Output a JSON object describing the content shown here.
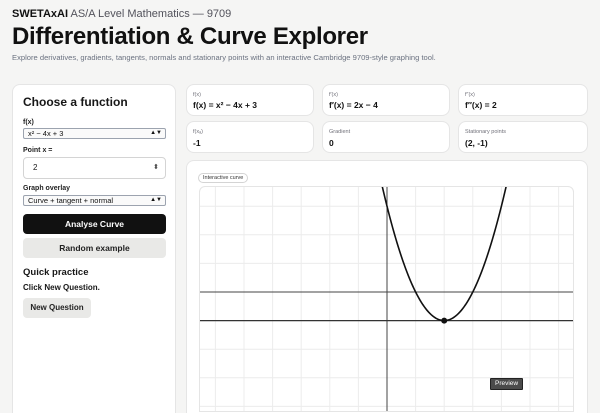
{
  "header": {
    "brand": "SWETAxAI",
    "course": "AS/A Level Mathematics — 9709",
    "title": "Differentiation & Curve Explorer",
    "subtitle": "Explore derivatives, gradients, tangents, normals and stationary points with an interactive Cambridge 9709-style graphing tool."
  },
  "panel": {
    "title": "Choose a function",
    "function_label": "f(x)",
    "function_value": "x² − 4x + 3",
    "point_label": "Point x =",
    "point_value": "2",
    "overlay_label": "Graph overlay",
    "overlay_value": "Curve + tangent + normal",
    "analyse_button": "Analyse Curve",
    "random_button": "Random example",
    "practice_title": "Quick practice",
    "practice_text": "Click New Question.",
    "new_question_button": "New Question"
  },
  "cards": {
    "fx_label": "f(x)",
    "fx_value": "f(x) = x² − 4x + 3",
    "d1_label": "f′(x)",
    "d1_value": "f′(x) = 2x − 4",
    "d2_label": "f″(x)",
    "d2_value": "f″(x) = 2",
    "fxa_label": "f(xₐ)",
    "fxa_value": "-1",
    "gradient_label": "Gradient",
    "gradient_value": "0",
    "stationary_label": "Stationary points",
    "stationary_value": "(2, -1)"
  },
  "graph": {
    "tag": "Interactive curve",
    "preview": "Preview"
  },
  "colors": {
    "primary_button": "#111111",
    "curve": "#111111"
  },
  "chart_data": {
    "type": "line",
    "function": "x^2 - 4x + 3",
    "x": [
      0.6,
      1,
      1.5,
      2,
      2.5,
      3,
      3.5,
      4,
      4.4
    ],
    "series": [
      {
        "values": [
          0.96,
          0,
          -0.75,
          -1,
          -0.75,
          0,
          1.25,
          3,
          4.76
        ]
      }
    ],
    "marked_point": {
      "x": 2,
      "y": -1
    },
    "tangent_y": -1,
    "xlim": [
      -6.7,
      6.7
    ],
    "ylim": [
      -4.5,
      4.5
    ],
    "grid": true
  }
}
